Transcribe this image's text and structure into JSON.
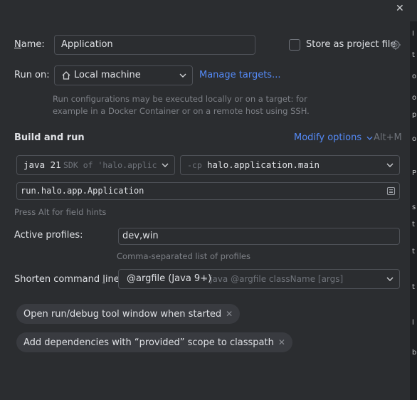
{
  "dialog": {
    "close_glyph": "✕"
  },
  "name": {
    "label": "Name:",
    "value": "Application"
  },
  "store": {
    "label": "Store as project file",
    "checked": false
  },
  "run_on": {
    "label": "Run on:",
    "target": "Local machine",
    "manage_link": "Manage targets...",
    "hint_line1": "Run configurations may be executed locally or on a target: for",
    "hint_line2": "example in a Docker Container or on a remote host using SSH."
  },
  "build": {
    "title": "Build and run",
    "modify_options": "Modify options",
    "shortcut": "Alt+M",
    "sdk_main": "java 21",
    "sdk_detail": "SDK of 'halo.applic",
    "cp_flag": "-cp",
    "cp_value": "halo.application.main",
    "main_class": "run.halo.app.Application",
    "field_hint": "Press Alt for field hints"
  },
  "profiles": {
    "label": "Active profiles:",
    "value": "dev,win",
    "hint": "Comma-separated list of profiles"
  },
  "shorten": {
    "label": "Shorten command line:",
    "value": "@argfile (Java 9+)",
    "detail": "- java @argfile className [args]"
  },
  "chips": [
    {
      "label": "Open run/debug tool window when started"
    },
    {
      "label": "Add dependencies with “provided” scope to classpath"
    }
  ]
}
